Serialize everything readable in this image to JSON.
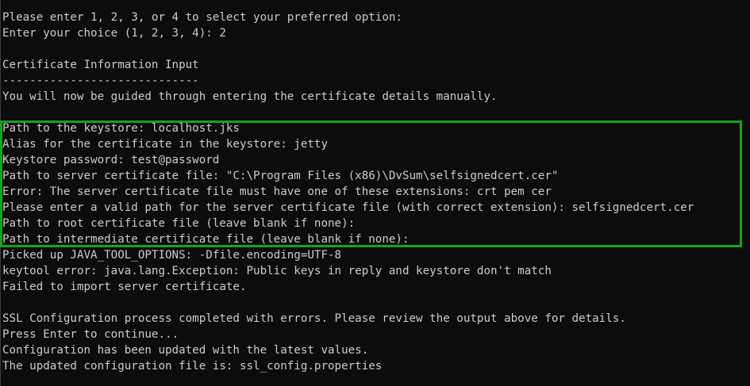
{
  "terminal": {
    "lines": [
      "Please enter 1, 2, 3, or 4 to select your preferred option:",
      "Enter your choice (1, 2, 3, 4): 2",
      "",
      "Certificate Information Input",
      "-----------------------------",
      "You will now be guided through entering the certificate details manually.",
      "",
      "Path to the keystore: localhost.jks",
      "Alias for the certificate in the keystore: jetty",
      "Keystore password: test@password",
      "Path to server certificate file: \"C:\\Program Files (x86)\\DvSum\\selfsignedcert.cer\"",
      "Error: The server certificate file must have one of these extensions: crt pem cer",
      "Please enter a valid path for the server certificate file (with correct extension): selfsignedcert.cer",
      "Path to root certificate file (leave blank if none):",
      "Path to intermediate certificate file (leave blank if none):",
      "Picked up JAVA_TOOL_OPTIONS: -Dfile.encoding=UTF-8",
      "keytool error: java.lang.Exception: Public keys in reply and keystore don't match",
      "Failed to import server certificate.",
      "",
      "SSL Configuration process completed with errors. Please review the output above for details.",
      "Press Enter to continue...",
      "Configuration has been updated with the latest values.",
      "The updated configuration file is: ssl_config.properties"
    ]
  },
  "colors": {
    "background": "#0c0c0c",
    "text": "#cccccc",
    "highlight_border": "#17a317"
  }
}
